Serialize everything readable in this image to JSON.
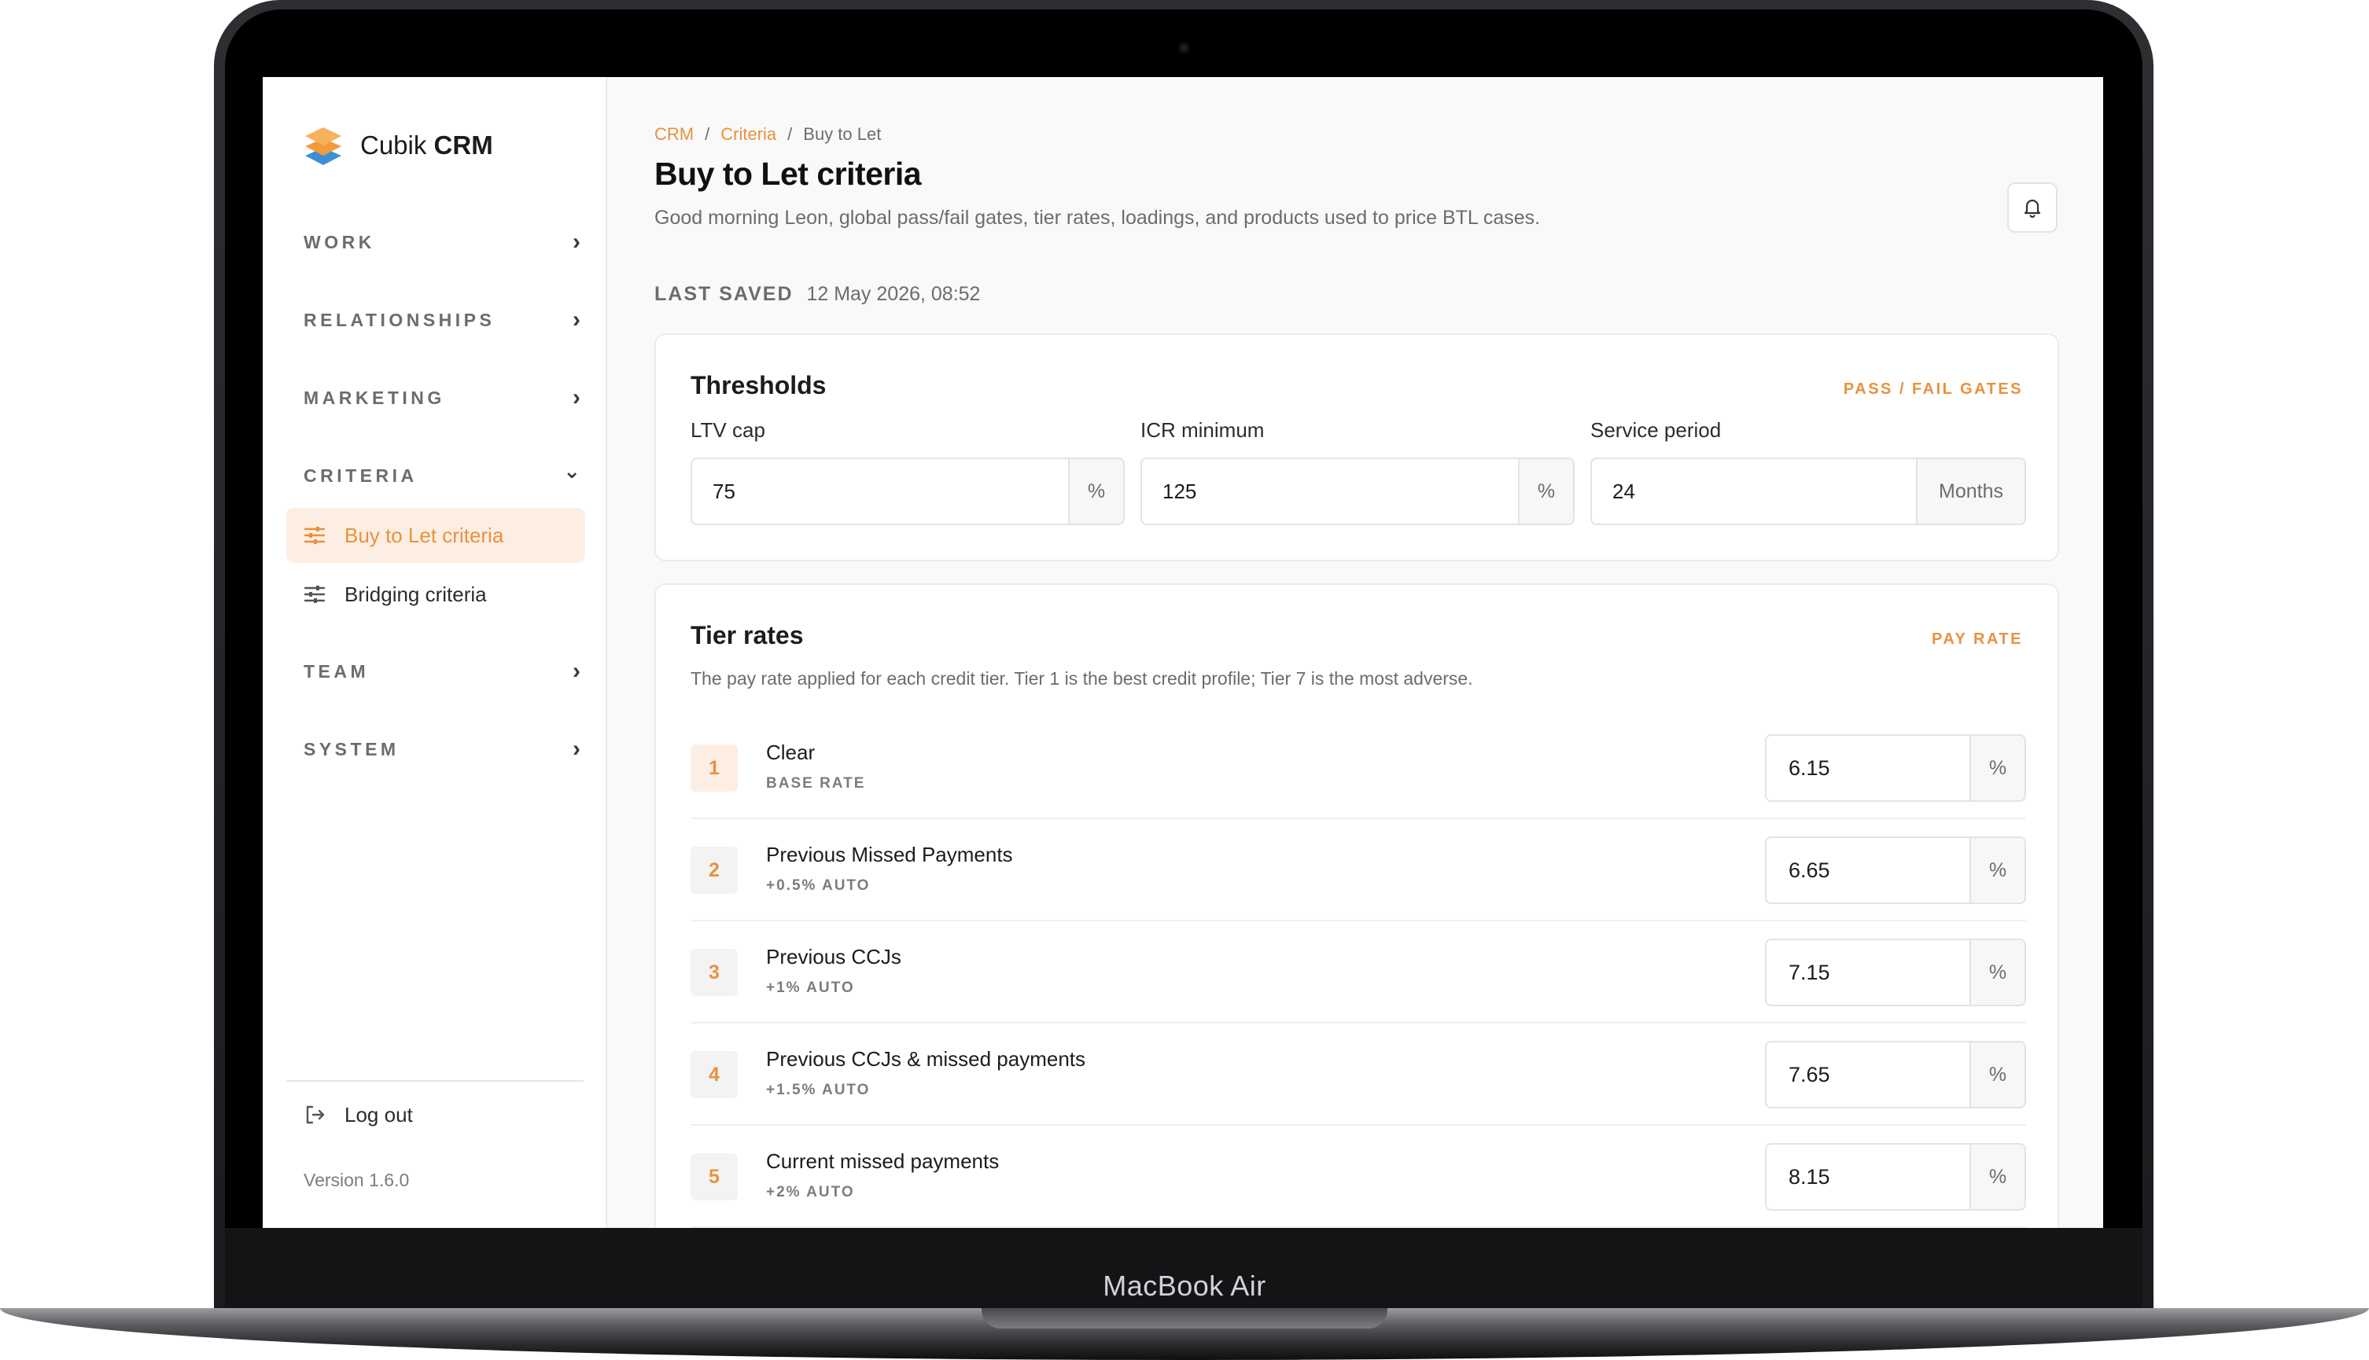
{
  "device": {
    "label": "MacBook Air"
  },
  "app": {
    "name_regular": "Cubik",
    "name_bold": "CRM"
  },
  "sidebar": {
    "sections": [
      {
        "label": "WORK",
        "chevron": "›"
      },
      {
        "label": "RELATIONSHIPS",
        "chevron": "›"
      },
      {
        "label": "MARKETING",
        "chevron": "›"
      },
      {
        "label": "CRITERIA",
        "chevron": "⌄"
      },
      {
        "label": "TEAM",
        "chevron": "›"
      },
      {
        "label": "SYSTEM",
        "chevron": "›"
      }
    ],
    "criteria_items": [
      {
        "label": "Buy to Let criteria",
        "icon": "sliders-icon",
        "active": true
      },
      {
        "label": "Bridging criteria",
        "icon": "sliders-icon",
        "active": false
      }
    ],
    "logout_label": "Log out",
    "version": "Version 1.6.0"
  },
  "breadcrumb": {
    "items": [
      "CRM",
      "Criteria",
      "Buy to Let"
    ],
    "separator": "/"
  },
  "page": {
    "title": "Buy to Let criteria",
    "subtitle": "Good morning Leon, global pass/fail gates, tier rates, loadings, and products used to price BTL cases.",
    "last_saved_label": "LAST SAVED",
    "last_saved_value": "12 May 2026, 08:52"
  },
  "thresholds": {
    "title": "Thresholds",
    "tag": "PASS / FAIL GATES",
    "fields": [
      {
        "label": "LTV cap",
        "value": "75",
        "unit": "%"
      },
      {
        "label": "ICR minimum",
        "value": "125",
        "unit": "%"
      },
      {
        "label": "Service period",
        "value": "24",
        "unit": "Months"
      }
    ]
  },
  "tiers": {
    "title": "Tier rates",
    "tag": "PAY RATE",
    "description": "The pay rate applied for each credit tier. Tier 1 is the best credit profile; Tier 7 is the most adverse.",
    "rows": [
      {
        "num": "1",
        "name": "Clear",
        "sub": "BASE RATE",
        "value": "6.15",
        "unit": "%"
      },
      {
        "num": "2",
        "name": "Previous Missed Payments",
        "sub": "+0.5% AUTO",
        "value": "6.65",
        "unit": "%"
      },
      {
        "num": "3",
        "name": "Previous CCJs",
        "sub": "+1% AUTO",
        "value": "7.15",
        "unit": "%"
      },
      {
        "num": "4",
        "name": "Previous CCJs & missed payments",
        "sub": "+1.5% AUTO",
        "value": "7.65",
        "unit": "%"
      },
      {
        "num": "5",
        "name": "Current missed payments",
        "sub": "+2% AUTO",
        "value": "8.15",
        "unit": "%"
      }
    ]
  },
  "colors": {
    "accent": "#e9913f",
    "accent_bg": "#fdeee3"
  }
}
